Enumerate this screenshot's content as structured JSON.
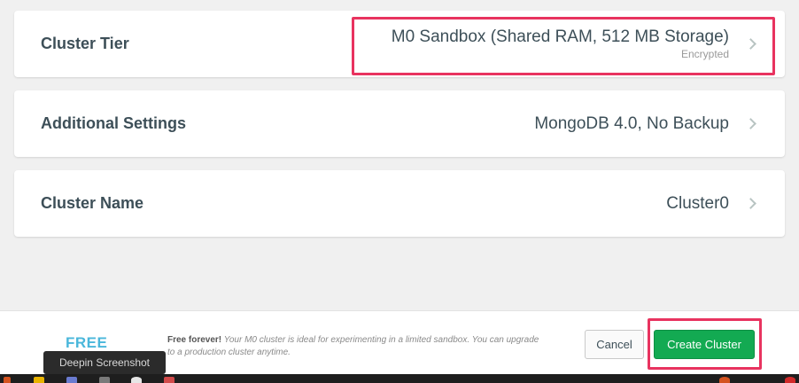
{
  "settings": {
    "cluster_tier": {
      "label": "Cluster Tier",
      "value": "M0 Sandbox (Shared RAM, 512 MB Storage)",
      "sub": "Encrypted"
    },
    "additional_settings": {
      "label": "Additional Settings",
      "value": "MongoDB 4.0, No Backup"
    },
    "cluster_name": {
      "label": "Cluster Name",
      "value": "Cluster0"
    }
  },
  "footer": {
    "free_label": "FREE",
    "free_bold": "Free forever!",
    "free_desc": " Your M0 cluster is ideal for experimenting in a limited sandbox. You can upgrade to a production cluster anytime.",
    "cancel_label": "Cancel",
    "create_label": "Create Cluster"
  },
  "tooltip": "Deepin Screenshot",
  "colors": {
    "highlight": "#e8335f",
    "create_button": "#13aa52",
    "free_accent": "#4ab7db"
  }
}
